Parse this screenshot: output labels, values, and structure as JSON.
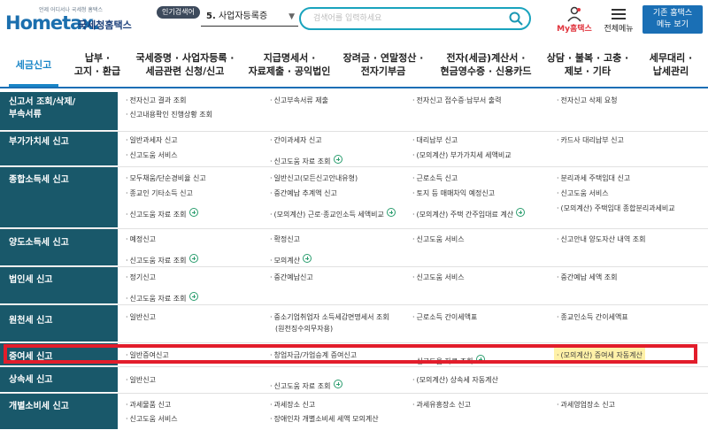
{
  "header": {
    "logo_tagline": "언제 어디서나 국세청 홈택스",
    "logo_main": "Hometax.",
    "logo_sub": "국세청홈택스",
    "popular_badge": "인기검색어",
    "popular_item_num": "5.",
    "popular_item_text": "사업자등록증",
    "search_placeholder": "검색어를 입력하세요",
    "my_hometax": "My홈택스",
    "all_menu": "전체메뉴",
    "classic_line1": "기존 홈택스",
    "classic_line2": "메뉴 보기"
  },
  "nav": {
    "items": [
      {
        "line1": "세금신고",
        "line2": ""
      },
      {
        "line1": "납부 ·",
        "line2": "고지 · 환급"
      },
      {
        "line1": "국세증명 · 사업자등록 ·",
        "line2": "세금관련 신청/신고"
      },
      {
        "line1": "지급명세서 ·",
        "line2": "자료제출 · 공익법인"
      },
      {
        "line1": "장려금 · 연말정산 ·",
        "line2": "전자기부금"
      },
      {
        "line1": "전자(세금)계산서 ·",
        "line2": "현금영수증 · 신용카드"
      },
      {
        "line1": "상담 · 불복 · 고충 ·",
        "line2": "제보 · 기타"
      },
      {
        "line1": "세무대리 ·",
        "line2": "납세관리"
      }
    ]
  },
  "rows": [
    {
      "head": [
        "신고서 조회/삭제/",
        "부속서류"
      ],
      "cells": [
        "전자신고 결과 조회",
        "신고부속서류 제출",
        "전자신고 접수증·납부서 출력",
        "전자신고 삭제 요청",
        "신고내용확인 진행상황 조회"
      ]
    },
    {
      "head": [
        "부가가치세 신고"
      ],
      "cells": [
        "일반과세자 신고",
        "간이과세자 신고",
        "대리납부 신고",
        "카드사 대리납부 신고",
        "신고도움 서비스",
        "신고도움 자료 조회",
        "(모의계산) 부가가치세 세액비교"
      ]
    },
    {
      "head": [
        "종합소득세 신고"
      ],
      "cells": [
        "모두채움/단순경비율 신고",
        "일반신고(모든신고안내유형)",
        "근로소득 신고",
        "분리과세 주택임대 신고",
        "종교인 기타소득 신고",
        "중간예납 추계액 신고",
        "토지 등 매매차익 예정신고",
        "신고도움 서비스",
        "신고도움 자료 조회",
        "(모의계산) 근로·종교인소득 세액비교",
        "(모의계산) 주택 간주임대료 계산",
        "(모의계산) 주택임대 종합분리과세비교"
      ]
    },
    {
      "head": [
        "양도소득세 신고"
      ],
      "cells": [
        "예정신고",
        "확정신고",
        "신고도움 서비스",
        "신고안내 양도자산 내역 조회",
        "신고도움 자료 조회",
        "모의계산"
      ]
    },
    {
      "head": [
        "법인세 신고"
      ],
      "cells": [
        "정기신고",
        "중간예납신고",
        "신고도움 서비스",
        "중간예납 세액 조회",
        "신고도움 자료 조회"
      ]
    },
    {
      "head": [
        "원천세 신고"
      ],
      "cells": [
        "일반신고",
        "중소기업취업자 소득세감면명세서 조회",
        "(원천징수의무자용)",
        "근로소득 간이세액표",
        "종교인소득 간이세액표"
      ]
    },
    {
      "head": [
        "증여세 신고"
      ],
      "cells": [
        "일반증여신고",
        "창업자금/가업승계 증여신고",
        "신고도움 자료 조회",
        "(모의계산) 증여세 자동계산"
      ]
    },
    {
      "head": [
        "상속세 신고"
      ],
      "cells": [
        "일반신고",
        "신고도움 자료 조회",
        "(모의계산) 상속세 자동계산"
      ]
    },
    {
      "head": [
        "개별소비세 신고"
      ],
      "cells": [
        "과세물품 신고",
        "과세장소 신고",
        "과세유흥장소 신고",
        "과세영업장소 신고",
        "신고도움 서비스",
        "장애인차 개별소비세 세액 모의계산"
      ]
    }
  ],
  "colors": {
    "accent": "#1a86c7",
    "row_head": "#19586a",
    "highlight_box": "#e21d2b"
  }
}
